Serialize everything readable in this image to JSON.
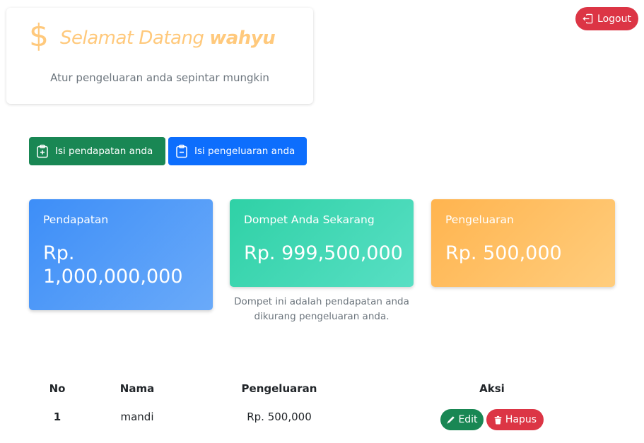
{
  "header": {
    "currency_symbol": "$",
    "greeting": "Selamat Datang",
    "username": "wahyu",
    "subtitle": "Atur pengeluaran anda sepintar mungkin",
    "logout_label": "Logout"
  },
  "actions": {
    "income_label": "Isi pendapatan anda",
    "expense_label": "Isi pengeluaran anda"
  },
  "summary": {
    "income": {
      "label": "Pendapatan",
      "value": "Rp. 1,000,000,000"
    },
    "wallet": {
      "label": "Dompet Anda Sekarang",
      "value": "Rp. 999,500,000",
      "note": "Dompet ini adalah pendapatan anda dikurang pengeluaran anda."
    },
    "expense": {
      "label": "Pengeluaran",
      "value": "Rp. 500,000"
    }
  },
  "table": {
    "headers": [
      "No",
      "Nama",
      "Pengeluaran",
      "Aksi"
    ],
    "rows": [
      {
        "no": "1",
        "nama": "mandi",
        "pengeluaran": "Rp. 500,000",
        "edit_label": "Edit",
        "delete_label": "Hapus"
      }
    ]
  },
  "colors": {
    "accent": "#ffc97c",
    "success": "#198754",
    "primary": "#0d6efd",
    "danger": "#dc3545",
    "income_card": "#4d99f8",
    "wallet_card": "#3fd8b4",
    "expense_card": "#ffbf64"
  },
  "icons": {
    "currency": "dollar-icon",
    "logout": "logout-icon",
    "income_button": "clipboard-plus-icon",
    "expense_button": "clipboard-minus-icon",
    "edit": "pencil-icon",
    "delete": "trash-icon"
  }
}
